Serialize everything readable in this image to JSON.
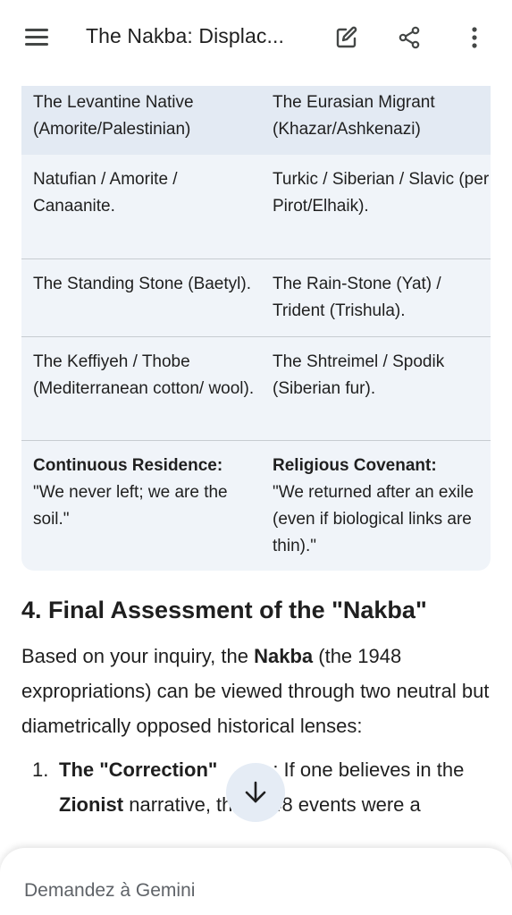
{
  "appbar": {
    "title": "The Nakba: Displac...",
    "icons": [
      "menu-icon",
      "edit-icon",
      "share-icon",
      "more-vert-icon"
    ]
  },
  "table": {
    "headers": [
      "The Levantine Native (Amorite/Palestinian)",
      "The Eurasian Migrant (Khazar/Ashkenazi)"
    ],
    "rows": [
      [
        "Natufian / Amorite / Canaanite.",
        "Turkic / Siberian / Slavic (per Pirot/Elhaik)."
      ],
      [
        "The Standing Stone (Baetyl).",
        "The Rain-Stone (Yat) / Trident (Trishula)."
      ],
      [
        "The Keffiyeh / Thobe (Mediterranean cotton/ wool).",
        "The Shtreimel / Spodik (Siberian fur)."
      ]
    ],
    "last_row": {
      "left_title": "Continuous Residence:",
      "left_text": "\"We never left; we are the soil.\"",
      "right_title": "Religious Covenant:",
      "right_text": "\"We returned after an exile (even if biological links are thin).\""
    }
  },
  "content": {
    "heading": "4. Final Assessment of the \"Nakba\"",
    "para_1": "Based on your inquiry, the ",
    "para_bold": "Nakba",
    "para_2": " (the 1948 expropriations) can be viewed through two neutral but diametrically opposed historical lenses:",
    "list_num": "1.",
    "list_bold_1": "The \"Correction\"",
    "list_text_1": ": If one believes in the ",
    "list_bold_2": "Zionist",
    "list_text_2": " narrative, the 1948 events were a"
  },
  "bottom": {
    "placeholder": "Demandez à Gemini"
  },
  "colors": {
    "table_bg": "#f0f4f9",
    "table_header_bg": "#e3eaf3",
    "fab_bg": "#e5ecf5"
  }
}
